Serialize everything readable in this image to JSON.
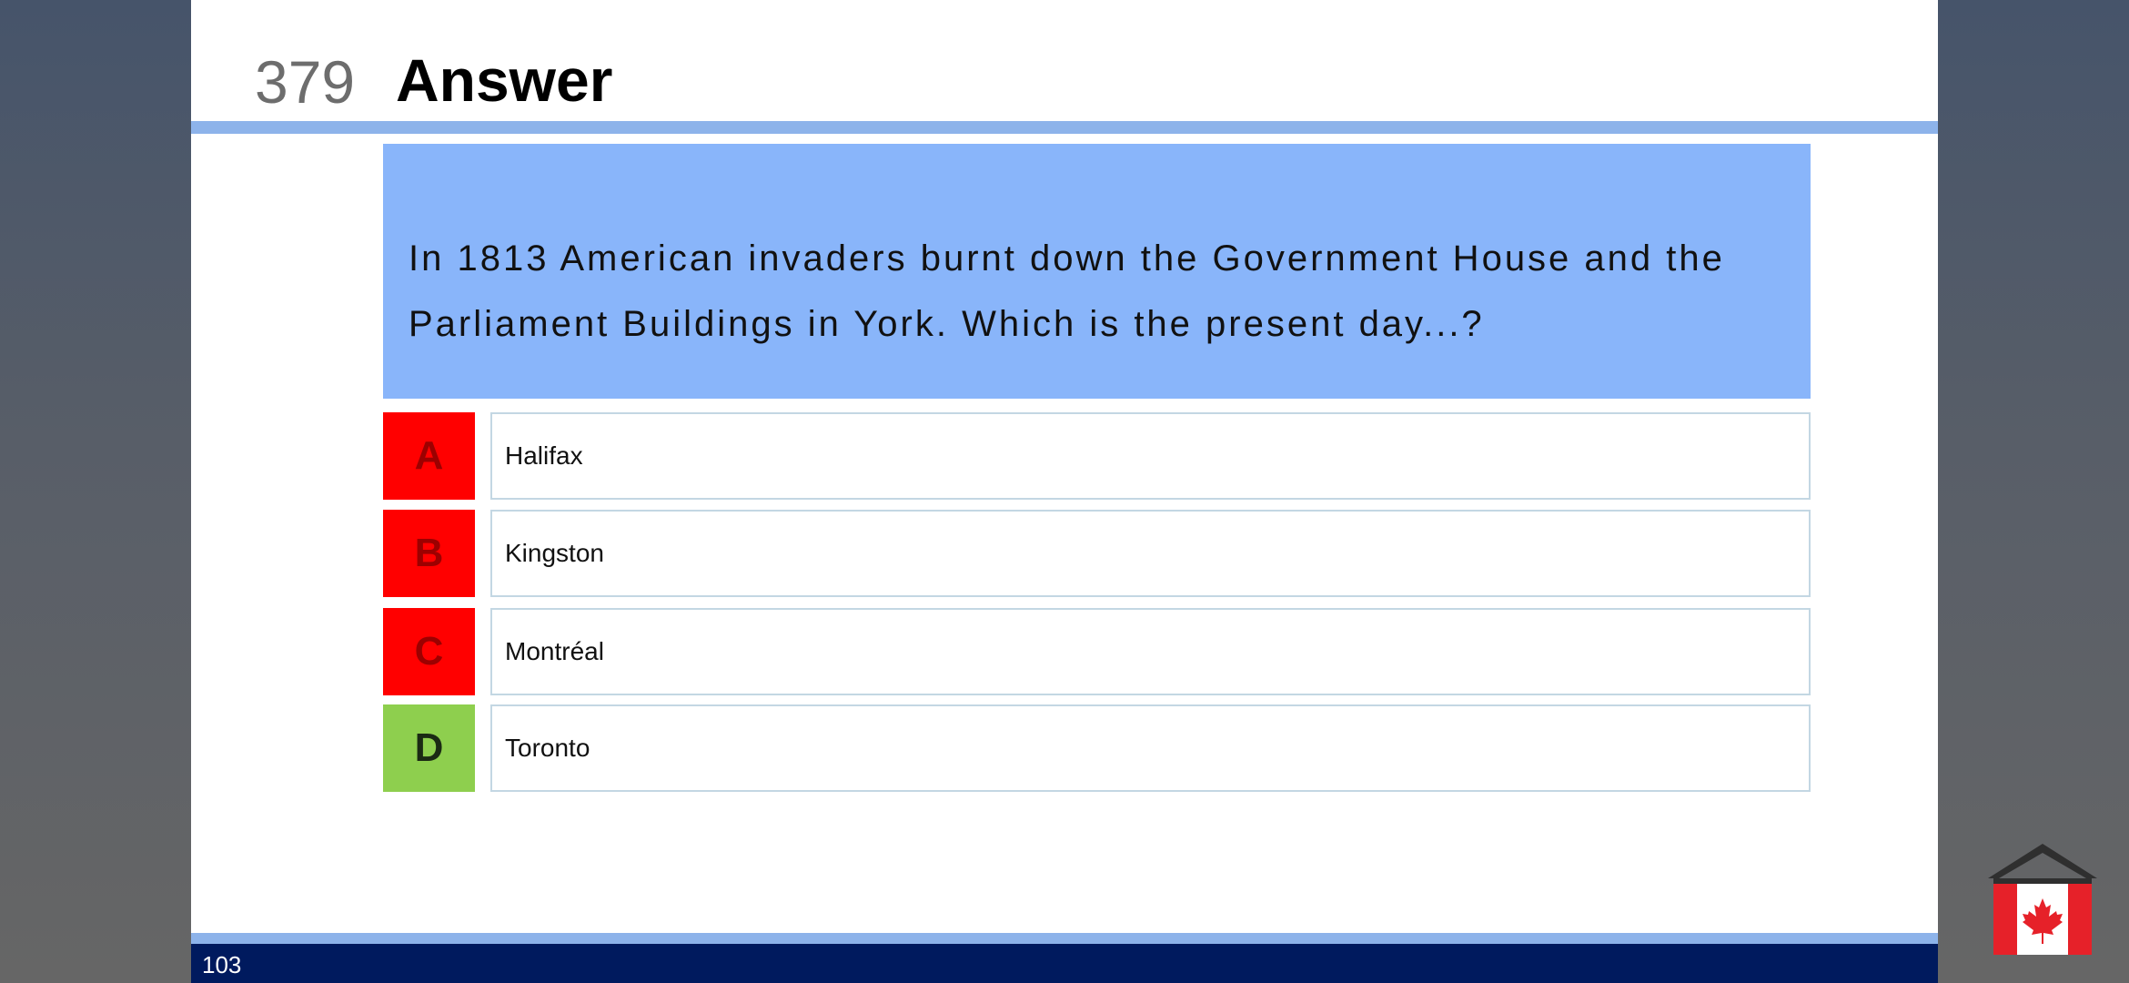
{
  "slide": {
    "question_number": "379",
    "title": "Answer",
    "question": "In 1813 American invaders burnt down the Government House and the Parliament Buildings in York. Which is the present day...?",
    "options": [
      {
        "letter": "A",
        "text": "Halifax",
        "status": "wrong"
      },
      {
        "letter": "B",
        "text": "Kingston",
        "status": "wrong"
      },
      {
        "letter": "C",
        "text": "Montréal",
        "status": "wrong"
      },
      {
        "letter": "D",
        "text": "Toronto",
        "status": "correct"
      }
    ],
    "page_number": "103"
  },
  "colors": {
    "accent_blue": "#8db3ea",
    "question_bg": "#89b5fa",
    "wrong": "#ff0000",
    "correct": "#8ecf4e",
    "footer": "#001a5e"
  },
  "icons": {
    "logo": "canada-flag-house-icon"
  }
}
